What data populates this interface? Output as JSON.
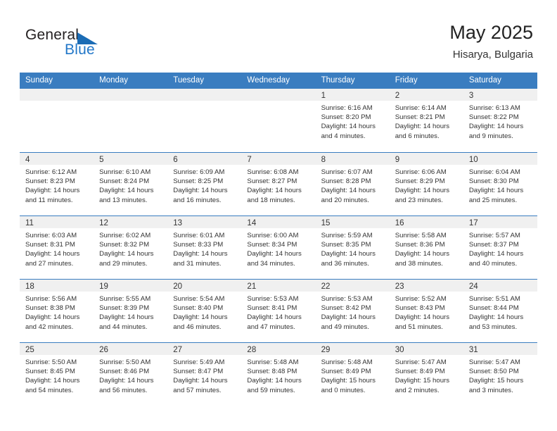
{
  "brand": {
    "name_top": "General",
    "name_bottom": "Blue",
    "triangle_color": "#1b6cb5",
    "blue_text_color": "#2277c8"
  },
  "header": {
    "title": "May 2025",
    "subtitle": "Hisarya, Bulgaria"
  },
  "theme": {
    "header_blue": "#3a7dc0",
    "day_band_gray": "#f0f0f0",
    "text_color": "#333333"
  },
  "weekdays": [
    "Sunday",
    "Monday",
    "Tuesday",
    "Wednesday",
    "Thursday",
    "Friday",
    "Saturday"
  ],
  "weeks": [
    [
      {
        "day": "",
        "sunrise": "",
        "sunset": "",
        "daylight_line1": "",
        "daylight_line2": ""
      },
      {
        "day": "",
        "sunrise": "",
        "sunset": "",
        "daylight_line1": "",
        "daylight_line2": ""
      },
      {
        "day": "",
        "sunrise": "",
        "sunset": "",
        "daylight_line1": "",
        "daylight_line2": ""
      },
      {
        "day": "",
        "sunrise": "",
        "sunset": "",
        "daylight_line1": "",
        "daylight_line2": ""
      },
      {
        "day": "1",
        "sunrise": "Sunrise: 6:16 AM",
        "sunset": "Sunset: 8:20 PM",
        "daylight_line1": "Daylight: 14 hours",
        "daylight_line2": "and 4 minutes."
      },
      {
        "day": "2",
        "sunrise": "Sunrise: 6:14 AM",
        "sunset": "Sunset: 8:21 PM",
        "daylight_line1": "Daylight: 14 hours",
        "daylight_line2": "and 6 minutes."
      },
      {
        "day": "3",
        "sunrise": "Sunrise: 6:13 AM",
        "sunset": "Sunset: 8:22 PM",
        "daylight_line1": "Daylight: 14 hours",
        "daylight_line2": "and 9 minutes."
      }
    ],
    [
      {
        "day": "4",
        "sunrise": "Sunrise: 6:12 AM",
        "sunset": "Sunset: 8:23 PM",
        "daylight_line1": "Daylight: 14 hours",
        "daylight_line2": "and 11 minutes."
      },
      {
        "day": "5",
        "sunrise": "Sunrise: 6:10 AM",
        "sunset": "Sunset: 8:24 PM",
        "daylight_line1": "Daylight: 14 hours",
        "daylight_line2": "and 13 minutes."
      },
      {
        "day": "6",
        "sunrise": "Sunrise: 6:09 AM",
        "sunset": "Sunset: 8:25 PM",
        "daylight_line1": "Daylight: 14 hours",
        "daylight_line2": "and 16 minutes."
      },
      {
        "day": "7",
        "sunrise": "Sunrise: 6:08 AM",
        "sunset": "Sunset: 8:27 PM",
        "daylight_line1": "Daylight: 14 hours",
        "daylight_line2": "and 18 minutes."
      },
      {
        "day": "8",
        "sunrise": "Sunrise: 6:07 AM",
        "sunset": "Sunset: 8:28 PM",
        "daylight_line1": "Daylight: 14 hours",
        "daylight_line2": "and 20 minutes."
      },
      {
        "day": "9",
        "sunrise": "Sunrise: 6:06 AM",
        "sunset": "Sunset: 8:29 PM",
        "daylight_line1": "Daylight: 14 hours",
        "daylight_line2": "and 23 minutes."
      },
      {
        "day": "10",
        "sunrise": "Sunrise: 6:04 AM",
        "sunset": "Sunset: 8:30 PM",
        "daylight_line1": "Daylight: 14 hours",
        "daylight_line2": "and 25 minutes."
      }
    ],
    [
      {
        "day": "11",
        "sunrise": "Sunrise: 6:03 AM",
        "sunset": "Sunset: 8:31 PM",
        "daylight_line1": "Daylight: 14 hours",
        "daylight_line2": "and 27 minutes."
      },
      {
        "day": "12",
        "sunrise": "Sunrise: 6:02 AM",
        "sunset": "Sunset: 8:32 PM",
        "daylight_line1": "Daylight: 14 hours",
        "daylight_line2": "and 29 minutes."
      },
      {
        "day": "13",
        "sunrise": "Sunrise: 6:01 AM",
        "sunset": "Sunset: 8:33 PM",
        "daylight_line1": "Daylight: 14 hours",
        "daylight_line2": "and 31 minutes."
      },
      {
        "day": "14",
        "sunrise": "Sunrise: 6:00 AM",
        "sunset": "Sunset: 8:34 PM",
        "daylight_line1": "Daylight: 14 hours",
        "daylight_line2": "and 34 minutes."
      },
      {
        "day": "15",
        "sunrise": "Sunrise: 5:59 AM",
        "sunset": "Sunset: 8:35 PM",
        "daylight_line1": "Daylight: 14 hours",
        "daylight_line2": "and 36 minutes."
      },
      {
        "day": "16",
        "sunrise": "Sunrise: 5:58 AM",
        "sunset": "Sunset: 8:36 PM",
        "daylight_line1": "Daylight: 14 hours",
        "daylight_line2": "and 38 minutes."
      },
      {
        "day": "17",
        "sunrise": "Sunrise: 5:57 AM",
        "sunset": "Sunset: 8:37 PM",
        "daylight_line1": "Daylight: 14 hours",
        "daylight_line2": "and 40 minutes."
      }
    ],
    [
      {
        "day": "18",
        "sunrise": "Sunrise: 5:56 AM",
        "sunset": "Sunset: 8:38 PM",
        "daylight_line1": "Daylight: 14 hours",
        "daylight_line2": "and 42 minutes."
      },
      {
        "day": "19",
        "sunrise": "Sunrise: 5:55 AM",
        "sunset": "Sunset: 8:39 PM",
        "daylight_line1": "Daylight: 14 hours",
        "daylight_line2": "and 44 minutes."
      },
      {
        "day": "20",
        "sunrise": "Sunrise: 5:54 AM",
        "sunset": "Sunset: 8:40 PM",
        "daylight_line1": "Daylight: 14 hours",
        "daylight_line2": "and 46 minutes."
      },
      {
        "day": "21",
        "sunrise": "Sunrise: 5:53 AM",
        "sunset": "Sunset: 8:41 PM",
        "daylight_line1": "Daylight: 14 hours",
        "daylight_line2": "and 47 minutes."
      },
      {
        "day": "22",
        "sunrise": "Sunrise: 5:53 AM",
        "sunset": "Sunset: 8:42 PM",
        "daylight_line1": "Daylight: 14 hours",
        "daylight_line2": "and 49 minutes."
      },
      {
        "day": "23",
        "sunrise": "Sunrise: 5:52 AM",
        "sunset": "Sunset: 8:43 PM",
        "daylight_line1": "Daylight: 14 hours",
        "daylight_line2": "and 51 minutes."
      },
      {
        "day": "24",
        "sunrise": "Sunrise: 5:51 AM",
        "sunset": "Sunset: 8:44 PM",
        "daylight_line1": "Daylight: 14 hours",
        "daylight_line2": "and 53 minutes."
      }
    ],
    [
      {
        "day": "25",
        "sunrise": "Sunrise: 5:50 AM",
        "sunset": "Sunset: 8:45 PM",
        "daylight_line1": "Daylight: 14 hours",
        "daylight_line2": "and 54 minutes."
      },
      {
        "day": "26",
        "sunrise": "Sunrise: 5:50 AM",
        "sunset": "Sunset: 8:46 PM",
        "daylight_line1": "Daylight: 14 hours",
        "daylight_line2": "and 56 minutes."
      },
      {
        "day": "27",
        "sunrise": "Sunrise: 5:49 AM",
        "sunset": "Sunset: 8:47 PM",
        "daylight_line1": "Daylight: 14 hours",
        "daylight_line2": "and 57 minutes."
      },
      {
        "day": "28",
        "sunrise": "Sunrise: 5:48 AM",
        "sunset": "Sunset: 8:48 PM",
        "daylight_line1": "Daylight: 14 hours",
        "daylight_line2": "and 59 minutes."
      },
      {
        "day": "29",
        "sunrise": "Sunrise: 5:48 AM",
        "sunset": "Sunset: 8:49 PM",
        "daylight_line1": "Daylight: 15 hours",
        "daylight_line2": "and 0 minutes."
      },
      {
        "day": "30",
        "sunrise": "Sunrise: 5:47 AM",
        "sunset": "Sunset: 8:49 PM",
        "daylight_line1": "Daylight: 15 hours",
        "daylight_line2": "and 2 minutes."
      },
      {
        "day": "31",
        "sunrise": "Sunrise: 5:47 AM",
        "sunset": "Sunset: 8:50 PM",
        "daylight_line1": "Daylight: 15 hours",
        "daylight_line2": "and 3 minutes."
      }
    ]
  ]
}
